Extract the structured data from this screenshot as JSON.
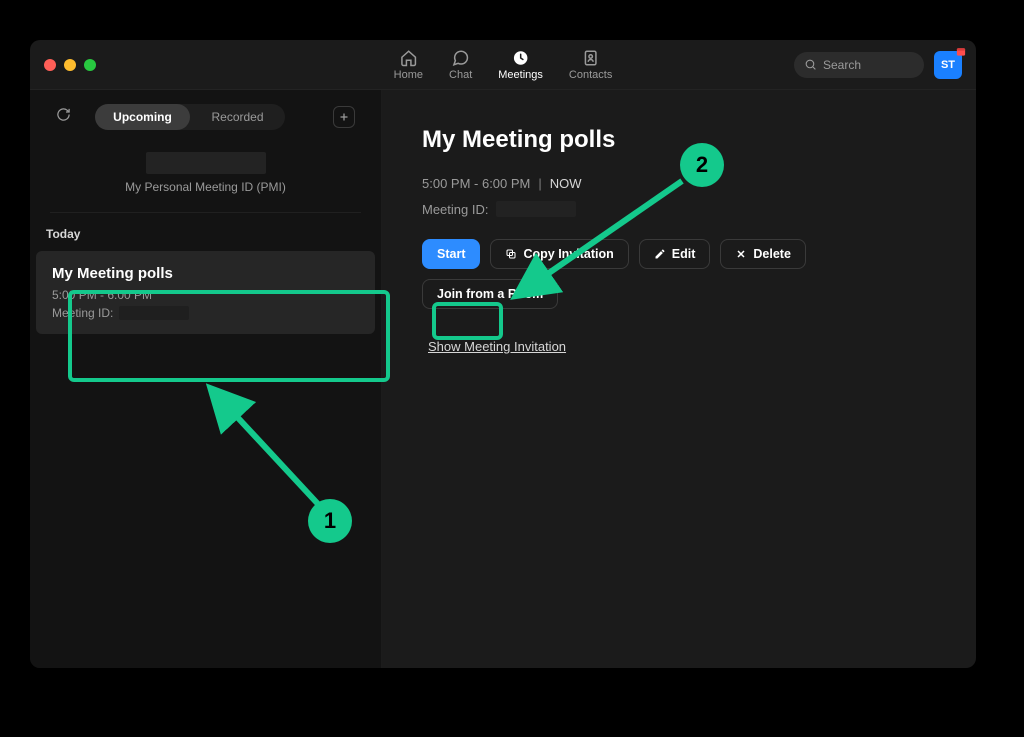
{
  "nav": {
    "home": "Home",
    "chat": "Chat",
    "meetings": "Meetings",
    "contacts": "Contacts"
  },
  "search": {
    "placeholder": "Search"
  },
  "avatar": {
    "initials": "ST"
  },
  "sidebar": {
    "tabs": {
      "upcoming": "Upcoming",
      "recorded": "Recorded"
    },
    "pmi_label": "My Personal Meeting ID (PMI)",
    "today_label": "Today",
    "meeting": {
      "title": "My Meeting polls",
      "time": "5:00 PM - 6:00 PM",
      "id_label": "Meeting ID:"
    }
  },
  "detail": {
    "title": "My Meeting polls",
    "time": "5:00 PM - 6:00 PM",
    "now_label": "NOW",
    "id_label": "Meeting ID:",
    "buttons": {
      "start": "Start",
      "copy": "Copy Invitation",
      "edit": "Edit",
      "delete": "Delete",
      "join_room": "Join from a Room"
    },
    "show_invitation": "Show Meeting Invitation"
  },
  "annotations": {
    "step1": "1",
    "step2": "2"
  },
  "colors": {
    "highlight": "#14c98c",
    "accent": "#2D8CFF"
  }
}
